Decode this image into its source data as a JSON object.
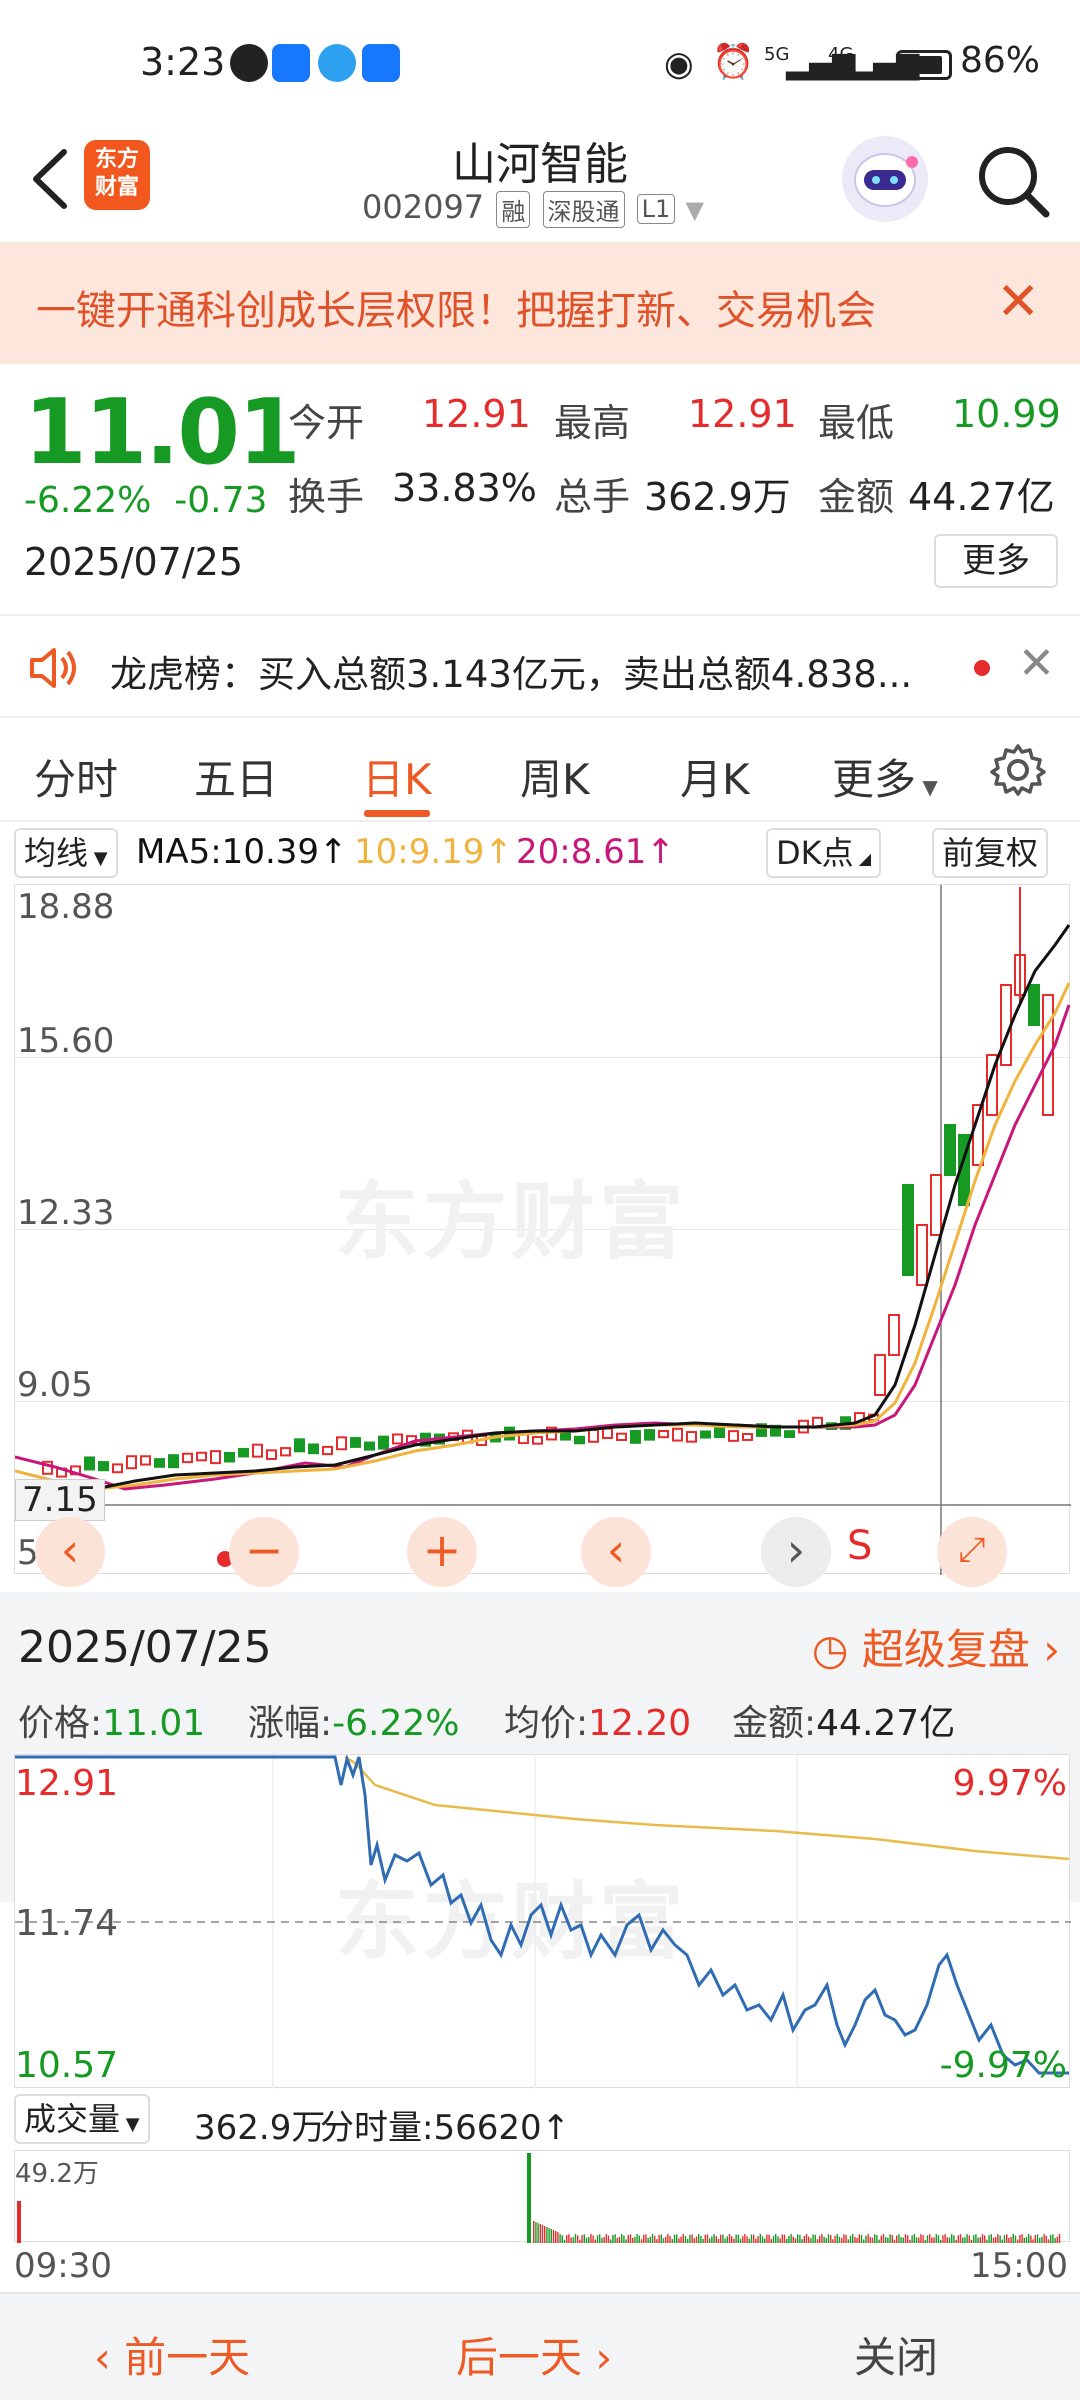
{
  "status_bar": {
    "time": "3:23",
    "network_5g": "5G",
    "network_4g": "4G",
    "battery": "86%"
  },
  "header": {
    "back_icon": "back-icon",
    "logo_text": "东方\n财富",
    "stock_name": "山河智能",
    "stock_code": "002097",
    "tags": [
      "融",
      "深股通",
      "L1"
    ],
    "search_icon": "search-icon"
  },
  "banner": {
    "text": "一键开通科创成长层权限！把握打新、交易机会",
    "close": "✕"
  },
  "quote": {
    "price": "11.01",
    "change_pct": "-6.22%",
    "change": "-0.73",
    "date": "2025/07/25",
    "open_label": "今开",
    "open": "12.91",
    "high_label": "最高",
    "high": "12.91",
    "low_label": "最低",
    "low": "10.99",
    "turnover_label": "换手",
    "turnover": "33.83%",
    "volume_label": "总手",
    "volume": "362.9万",
    "amount_label": "金额",
    "amount": "44.27亿",
    "more_label": "更多"
  },
  "longhu": {
    "text": "龙虎榜：买入总额3.143亿元，卖出总额4.838..."
  },
  "tabs": [
    "分时",
    "五日",
    "日K",
    "周K",
    "月K",
    "更多"
  ],
  "active_tab": "日K",
  "ma_row": {
    "selector": "均线",
    "ma5": "MA5:10.39↑",
    "ma10": "10:9.19↑",
    "ma20": "20:8.61↑",
    "dk": "DK点",
    "adjust": "前复权"
  },
  "kchart": {
    "y_labels": [
      "18.88",
      "15.60",
      "12.33",
      "9.05",
      "7.15",
      "5.77"
    ],
    "watermark": "东方财富",
    "s_marker": "S"
  },
  "review": {
    "date": "2025/07/25",
    "super_review": "超级复盘",
    "price_label": "价格:",
    "price": "11.01",
    "chg_label": "涨幅:",
    "chg": "-6.22%",
    "avg_label": "均价:",
    "avg": "12.20",
    "amount_label": "金额:",
    "amount": "44.27亿"
  },
  "intraday": {
    "top_price": "12.91",
    "mid_price": "11.74",
    "bottom_price": "10.57",
    "top_pct": "9.97%",
    "bottom_pct": "-9.97%"
  },
  "volume": {
    "selector": "成交量",
    "total": "362.9万",
    "minute_vol": "分时量:56620↑",
    "max_label": "49.2万",
    "time_start": "09:30",
    "time_end": "15:00"
  },
  "bottom_nav": {
    "prev": "前一天",
    "next": "后一天",
    "close": "关闭"
  },
  "colors": {
    "up": "#e52b2b",
    "down": "#179a24",
    "accent": "#ee5a24",
    "ma5": "#111111",
    "ma10": "#f0b33c",
    "ma20": "#c8167a"
  }
}
